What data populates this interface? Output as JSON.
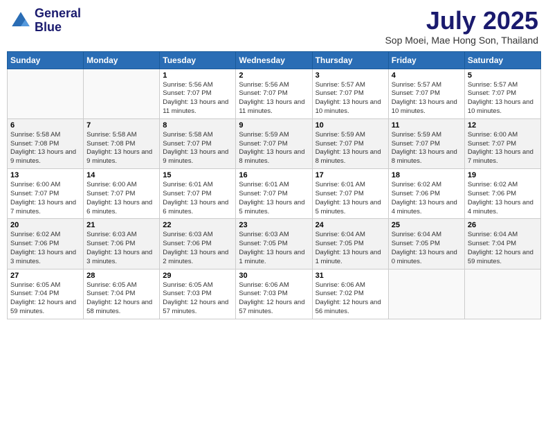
{
  "header": {
    "logo_line1": "General",
    "logo_line2": "Blue",
    "month_title": "July 2025",
    "subtitle": "Sop Moei, Mae Hong Son, Thailand"
  },
  "weekdays": [
    "Sunday",
    "Monday",
    "Tuesday",
    "Wednesday",
    "Thursday",
    "Friday",
    "Saturday"
  ],
  "weeks": [
    [
      {
        "day": "",
        "info": ""
      },
      {
        "day": "",
        "info": ""
      },
      {
        "day": "1",
        "info": "Sunrise: 5:56 AM\nSunset: 7:07 PM\nDaylight: 13 hours\nand 11 minutes."
      },
      {
        "day": "2",
        "info": "Sunrise: 5:56 AM\nSunset: 7:07 PM\nDaylight: 13 hours\nand 11 minutes."
      },
      {
        "day": "3",
        "info": "Sunrise: 5:57 AM\nSunset: 7:07 PM\nDaylight: 13 hours\nand 10 minutes."
      },
      {
        "day": "4",
        "info": "Sunrise: 5:57 AM\nSunset: 7:07 PM\nDaylight: 13 hours\nand 10 minutes."
      },
      {
        "day": "5",
        "info": "Sunrise: 5:57 AM\nSunset: 7:07 PM\nDaylight: 13 hours\nand 10 minutes."
      }
    ],
    [
      {
        "day": "6",
        "info": "Sunrise: 5:58 AM\nSunset: 7:08 PM\nDaylight: 13 hours\nand 9 minutes."
      },
      {
        "day": "7",
        "info": "Sunrise: 5:58 AM\nSunset: 7:08 PM\nDaylight: 13 hours\nand 9 minutes."
      },
      {
        "day": "8",
        "info": "Sunrise: 5:58 AM\nSunset: 7:07 PM\nDaylight: 13 hours\nand 9 minutes."
      },
      {
        "day": "9",
        "info": "Sunrise: 5:59 AM\nSunset: 7:07 PM\nDaylight: 13 hours\nand 8 minutes."
      },
      {
        "day": "10",
        "info": "Sunrise: 5:59 AM\nSunset: 7:07 PM\nDaylight: 13 hours\nand 8 minutes."
      },
      {
        "day": "11",
        "info": "Sunrise: 5:59 AM\nSunset: 7:07 PM\nDaylight: 13 hours\nand 8 minutes."
      },
      {
        "day": "12",
        "info": "Sunrise: 6:00 AM\nSunset: 7:07 PM\nDaylight: 13 hours\nand 7 minutes."
      }
    ],
    [
      {
        "day": "13",
        "info": "Sunrise: 6:00 AM\nSunset: 7:07 PM\nDaylight: 13 hours\nand 7 minutes."
      },
      {
        "day": "14",
        "info": "Sunrise: 6:00 AM\nSunset: 7:07 PM\nDaylight: 13 hours\nand 6 minutes."
      },
      {
        "day": "15",
        "info": "Sunrise: 6:01 AM\nSunset: 7:07 PM\nDaylight: 13 hours\nand 6 minutes."
      },
      {
        "day": "16",
        "info": "Sunrise: 6:01 AM\nSunset: 7:07 PM\nDaylight: 13 hours\nand 5 minutes."
      },
      {
        "day": "17",
        "info": "Sunrise: 6:01 AM\nSunset: 7:07 PM\nDaylight: 13 hours\nand 5 minutes."
      },
      {
        "day": "18",
        "info": "Sunrise: 6:02 AM\nSunset: 7:06 PM\nDaylight: 13 hours\nand 4 minutes."
      },
      {
        "day": "19",
        "info": "Sunrise: 6:02 AM\nSunset: 7:06 PM\nDaylight: 13 hours\nand 4 minutes."
      }
    ],
    [
      {
        "day": "20",
        "info": "Sunrise: 6:02 AM\nSunset: 7:06 PM\nDaylight: 13 hours\nand 3 minutes."
      },
      {
        "day": "21",
        "info": "Sunrise: 6:03 AM\nSunset: 7:06 PM\nDaylight: 13 hours\nand 3 minutes."
      },
      {
        "day": "22",
        "info": "Sunrise: 6:03 AM\nSunset: 7:06 PM\nDaylight: 13 hours\nand 2 minutes."
      },
      {
        "day": "23",
        "info": "Sunrise: 6:03 AM\nSunset: 7:05 PM\nDaylight: 13 hours\nand 1 minute."
      },
      {
        "day": "24",
        "info": "Sunrise: 6:04 AM\nSunset: 7:05 PM\nDaylight: 13 hours\nand 1 minute."
      },
      {
        "day": "25",
        "info": "Sunrise: 6:04 AM\nSunset: 7:05 PM\nDaylight: 13 hours\nand 0 minutes."
      },
      {
        "day": "26",
        "info": "Sunrise: 6:04 AM\nSunset: 7:04 PM\nDaylight: 12 hours\nand 59 minutes."
      }
    ],
    [
      {
        "day": "27",
        "info": "Sunrise: 6:05 AM\nSunset: 7:04 PM\nDaylight: 12 hours\nand 59 minutes."
      },
      {
        "day": "28",
        "info": "Sunrise: 6:05 AM\nSunset: 7:04 PM\nDaylight: 12 hours\nand 58 minutes."
      },
      {
        "day": "29",
        "info": "Sunrise: 6:05 AM\nSunset: 7:03 PM\nDaylight: 12 hours\nand 57 minutes."
      },
      {
        "day": "30",
        "info": "Sunrise: 6:06 AM\nSunset: 7:03 PM\nDaylight: 12 hours\nand 57 minutes."
      },
      {
        "day": "31",
        "info": "Sunrise: 6:06 AM\nSunset: 7:02 PM\nDaylight: 12 hours\nand 56 minutes."
      },
      {
        "day": "",
        "info": ""
      },
      {
        "day": "",
        "info": ""
      }
    ]
  ]
}
